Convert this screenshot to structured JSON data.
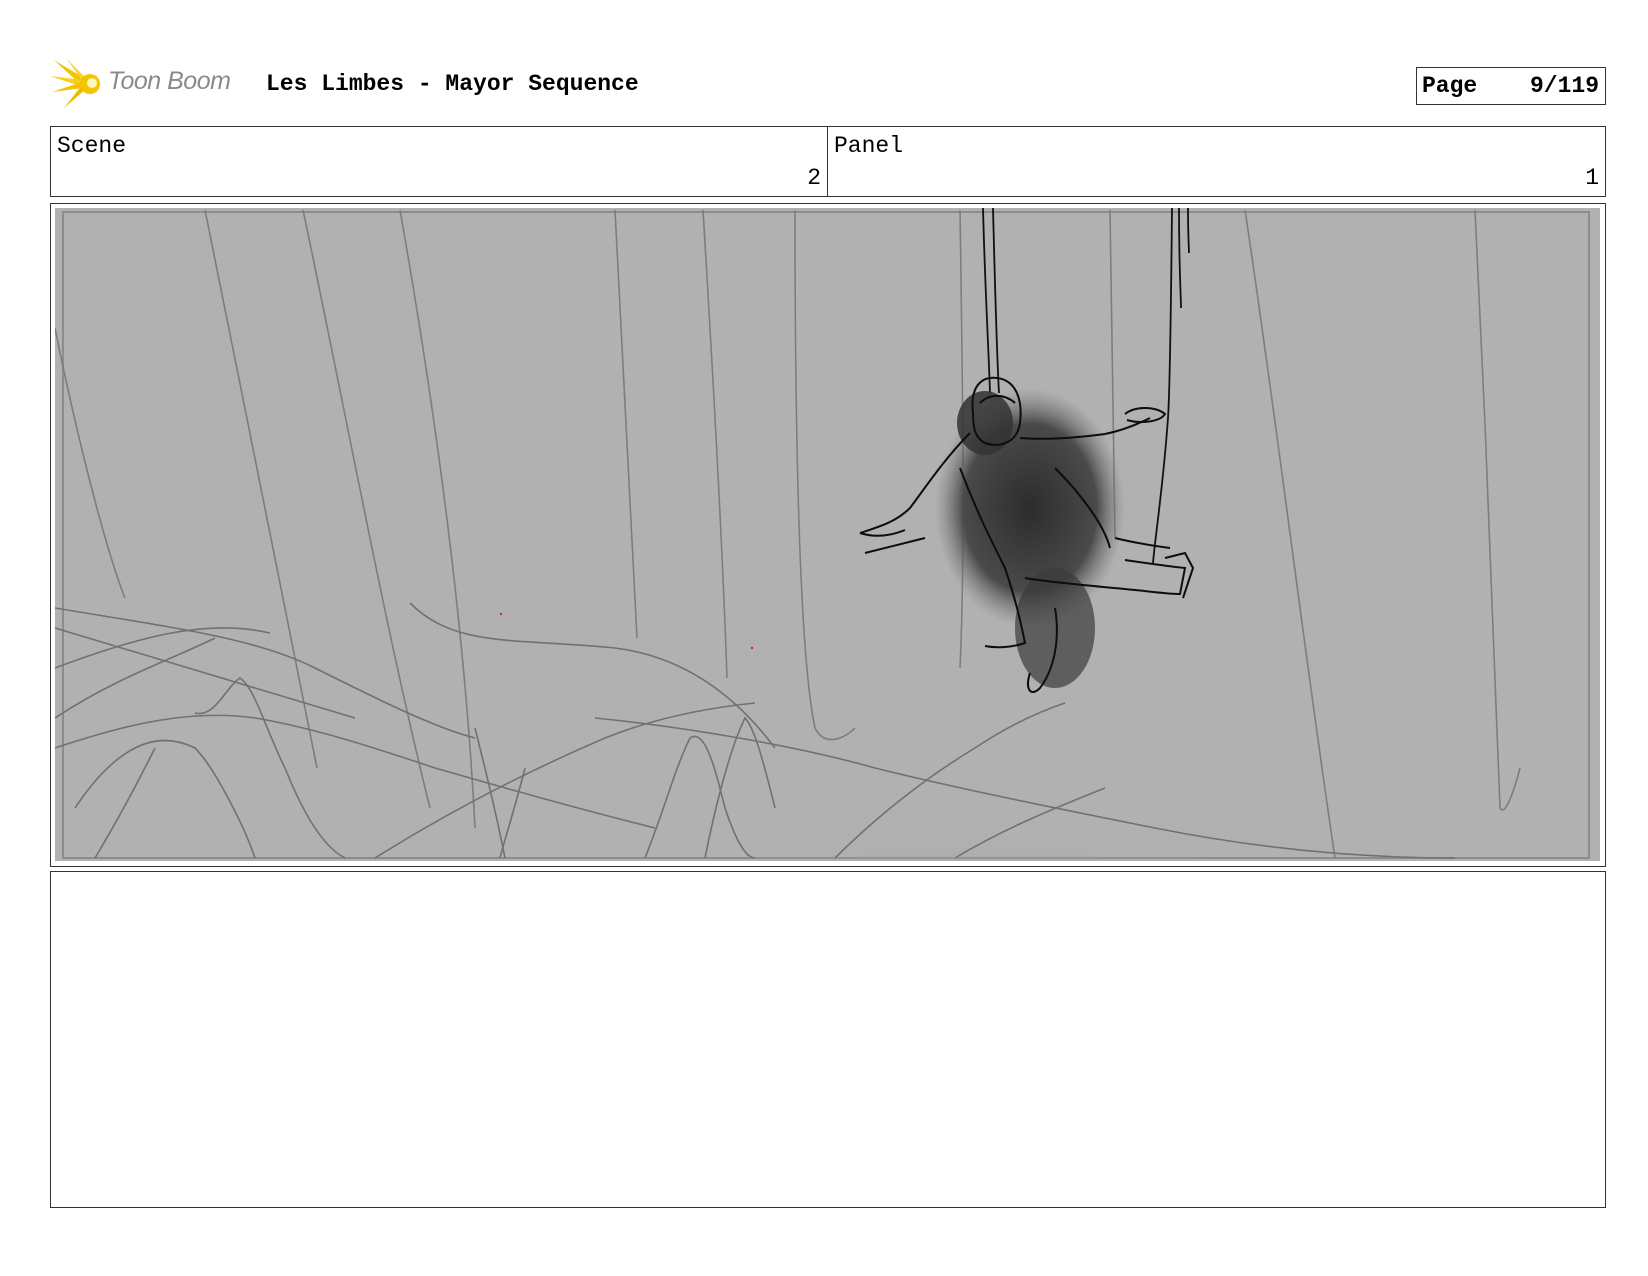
{
  "header": {
    "logo_text": "Toon Boom",
    "title": "Les Limbes - Mayor Sequence",
    "page_label": "Page",
    "page_value": "9/119"
  },
  "info": {
    "scene_label": "Scene",
    "scene_value": "2",
    "panel_label": "Panel",
    "panel_value": "1"
  },
  "colors": {
    "logo_yellow": "#f5c400",
    "panel_background": "#b1b1b1"
  },
  "icons": {
    "logo": "toon-boom-burst-icon"
  },
  "notes": {
    "text": ""
  }
}
